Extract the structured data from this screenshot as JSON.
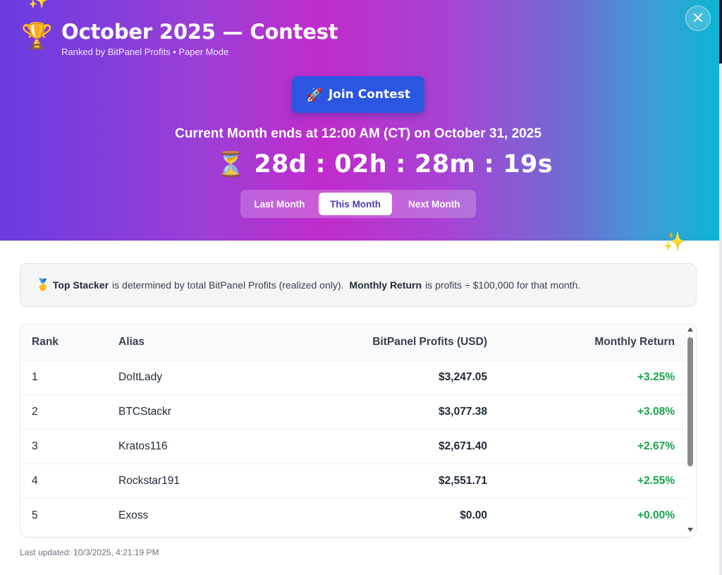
{
  "header": {
    "title": "October 2025 — Contest",
    "subtitle": "Ranked by BitPanel Profits • Paper Mode",
    "trophy_icon": "🏆",
    "close_label": "×",
    "join_button": {
      "icon": "🚀",
      "label": "Join Contest"
    },
    "ends_text": "Current Month ends at 12:00 AM (CT) on October 31, 2025",
    "countdown": {
      "icon": "⏳",
      "text": "28d : 02h : 28m : 19s"
    },
    "month_tabs": [
      {
        "label": "Last Month",
        "active": false
      },
      {
        "label": "This Month",
        "active": true
      },
      {
        "label": "Next Month",
        "active": false
      }
    ],
    "sparkle_icon": "✨",
    "colors": {
      "gradient_start": "#6a3be0",
      "gradient_mid": "#c02ccc",
      "gradient_end": "#0bb5d3",
      "join_button": "#2a56e2"
    }
  },
  "info": {
    "medal_icon": "🥇",
    "term1": "Top Stacker",
    "text1": "is determined by total BitPanel Profits (realized only).",
    "term2": "Monthly Return",
    "text2": "is profits ÷ $100,000 for that month."
  },
  "table": {
    "headers": {
      "rank": "Rank",
      "alias": "Alias",
      "profits": "BitPanel Profits (USD)",
      "return": "Monthly Return"
    },
    "rows": [
      {
        "rank": "1",
        "alias": "DoItLady",
        "profits": "$3,247.05",
        "return": "+3.25%"
      },
      {
        "rank": "2",
        "alias": "BTCStackr",
        "profits": "$3,077.38",
        "return": "+3.08%"
      },
      {
        "rank": "3",
        "alias": "Kratos116",
        "profits": "$2,671.40",
        "return": "+2.67%"
      },
      {
        "rank": "4",
        "alias": "Rockstar191",
        "profits": "$2,551.71",
        "return": "+2.55%"
      },
      {
        "rank": "5",
        "alias": "Exoss",
        "profits": "$0.00",
        "return": "+0.00%"
      }
    ],
    "return_color": "#16a34a"
  },
  "footer": {
    "last_updated": "Last updated: 10/3/2025, 4:21:19 PM"
  }
}
